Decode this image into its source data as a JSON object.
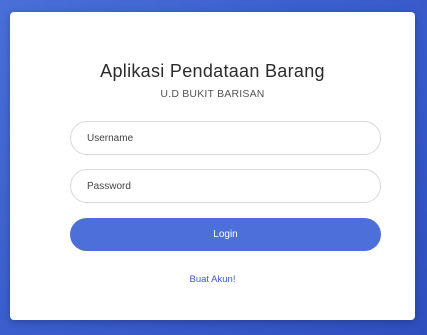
{
  "app": {
    "title": "Aplikasi Pendataan Barang",
    "subtitle": "U.D BUKIT BARISAN"
  },
  "form": {
    "username_placeholder": "Username",
    "username_value": "",
    "password_placeholder": "Password",
    "password_value": "",
    "login_label": "Login",
    "create_account_label": "Buat Akun!"
  },
  "colors": {
    "background": "#3c5fcf",
    "button": "#4d6fd9",
    "link": "#3a5cc9"
  }
}
